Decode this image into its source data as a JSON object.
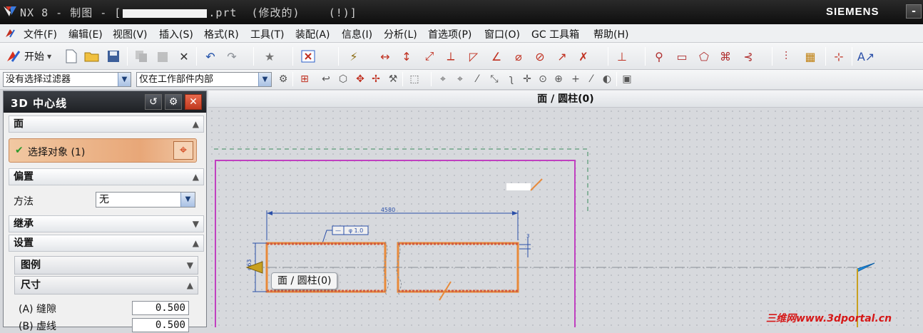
{
  "window": {
    "title_prefix": "NX 8 - 制图 - [",
    "title_suffix": ".prt  (修改的)    (!)]",
    "brand": "SIEMENS",
    "minimize_symbol": "-"
  },
  "menu": [
    "文件(F)",
    "编辑(E)",
    "视图(V)",
    "插入(S)",
    "格式(R)",
    "工具(T)",
    "装配(A)",
    "信息(I)",
    "分析(L)",
    "首选项(P)",
    "窗口(O)",
    "GC 工具箱",
    "帮助(H)"
  ],
  "toolbar": {
    "start_label": "开始",
    "filter_combo": "没有选择过滤器",
    "scope_combo": "仅在工作部件内部"
  },
  "dialog": {
    "title": "3D 中心线",
    "sections": {
      "face": "面",
      "select_object": "选择对象 (1)",
      "offset": "偏置",
      "method_label": "方法",
      "method_value": "无",
      "inherit": "继承",
      "settings": "设置",
      "legend": "图例",
      "dimensions": "尺寸",
      "gap_label": "(A) 缝隙",
      "gap_value": "0.500",
      "dash_label": "(B) 虚线",
      "dash_value": "0.500"
    }
  },
  "graphics": {
    "title": "面 / 圆柱(0)",
    "tooltip": "面 / 圆柱(0)",
    "dim_length": "4580",
    "dim_diameter": "φ63",
    "fcf_symbol": "—",
    "fcf_value": "φ 1.0",
    "side_dim": "3"
  },
  "watermark": "三维网www.3dportal.cn",
  "colors": {
    "title_bg": "#1e1e1e",
    "selection_highlight": "#e8a778",
    "sheet_border": "#c040c0",
    "part_outline": "#e88a3a",
    "watermark": "#d61818"
  }
}
